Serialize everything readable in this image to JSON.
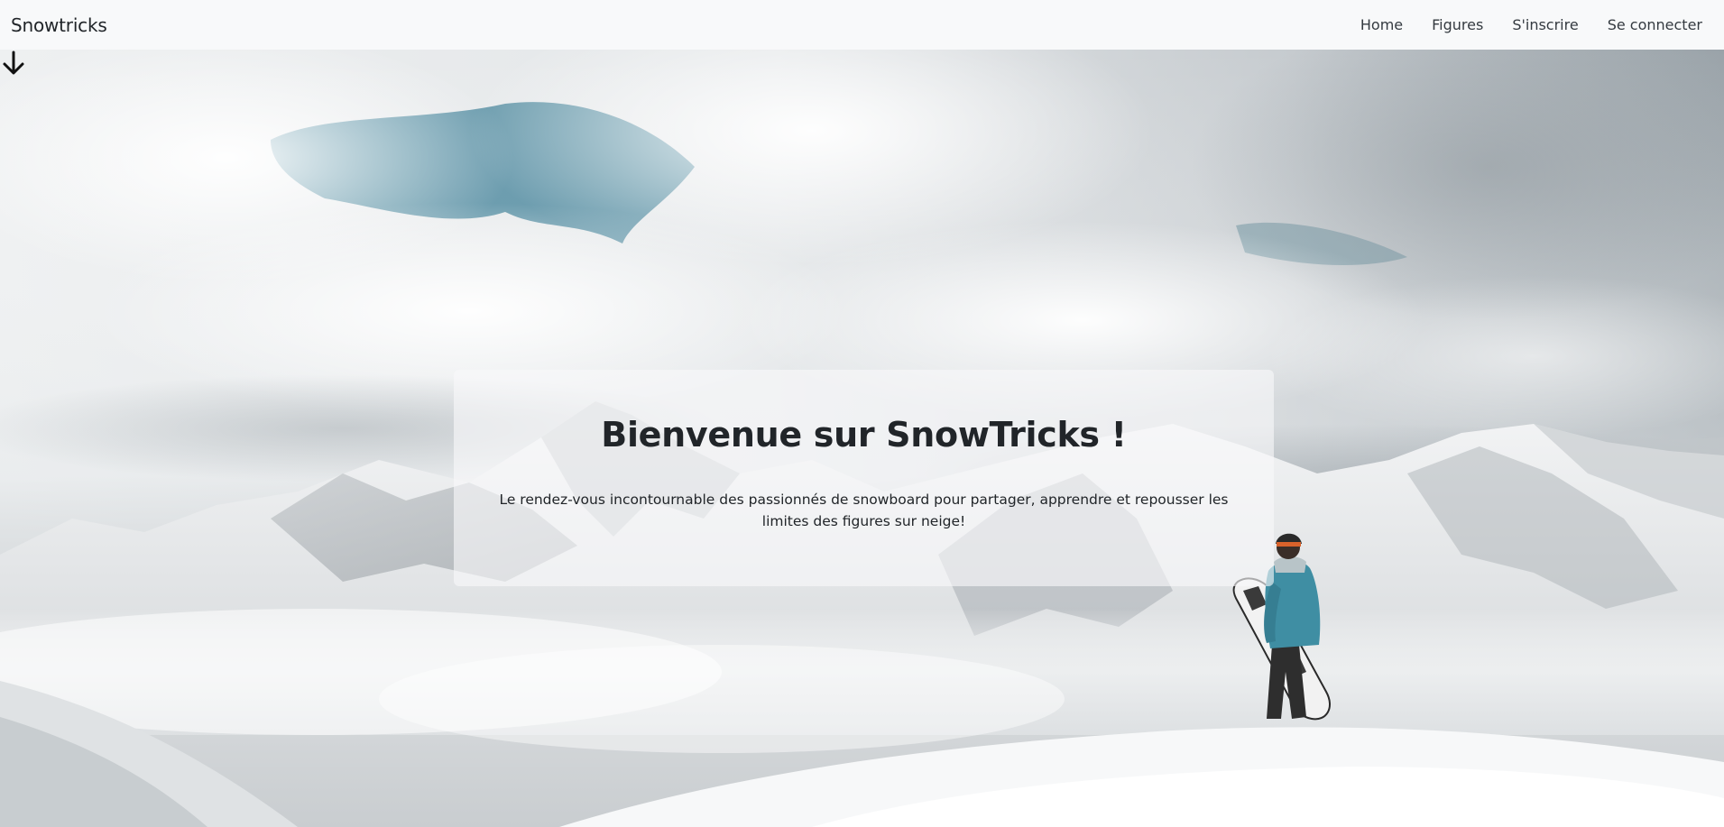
{
  "navbar": {
    "brand": "Snowtricks",
    "links": [
      "Home",
      "Figures",
      "S'inscrire",
      "Se connecter"
    ]
  },
  "hero": {
    "image": "snowboarder-on-snowy-mountain-peak",
    "title": "Bienvenue sur SnowTricks !",
    "text": "Le rendez-vous incontournable des passionnés de snowboard pour partager, apprendre et repousser les limites des figures sur neige!",
    "scroll_icon": "arrow-down-icon"
  },
  "colors": {
    "navbar_bg": "#f8f9fa",
    "text": "#212529",
    "sky_blue": "#5a93a6",
    "jacket": "#3f8ea3"
  }
}
